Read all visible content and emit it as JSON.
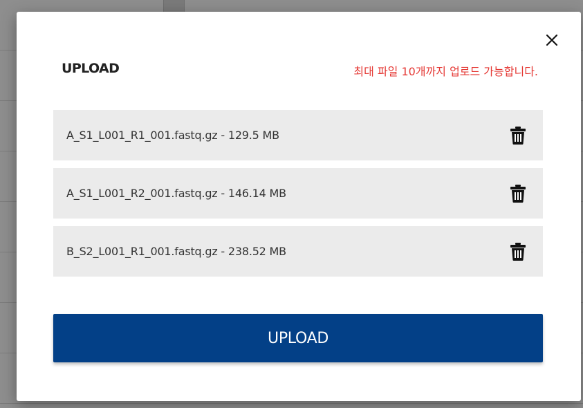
{
  "modal": {
    "title": "UPLOAD",
    "limit_notice": "최대 파일 10개까지 업로드 가능합니다.",
    "close_icon": "close-icon",
    "delete_icon": "trash-icon",
    "colors": {
      "accent": "#034087",
      "notice": "#e53935",
      "row_background": "#ebebeb"
    },
    "files": [
      {
        "label": "A_S1_L001_R1_001.fastq.gz - 129.5 MB"
      },
      {
        "label": "A_S1_L001_R2_001.fastq.gz - 146.14 MB"
      },
      {
        "label": "B_S2_L001_R1_001.fastq.gz - 238.52 MB"
      }
    ],
    "upload_button_label": "UPLOAD"
  }
}
